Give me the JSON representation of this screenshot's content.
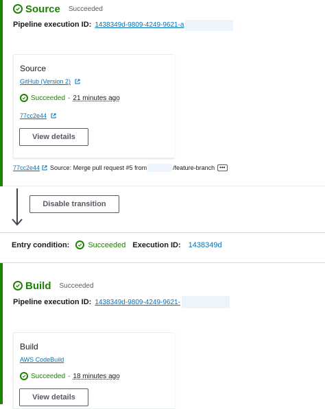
{
  "source_stage": {
    "title": "Source",
    "status": "Succeeded",
    "execution_label": "Pipeline execution ID:",
    "execution_id": "1438349d-9809-4249-9621-a",
    "action": {
      "name": "Source",
      "provider": "GitHub (Version 2)",
      "status": "Succeeded",
      "separator": "-",
      "time": "21 minutes ago",
      "commit": "77cc2e44",
      "view_details": "View details"
    },
    "footer": {
      "commit": "77cc2e44",
      "text": "Source: Merge pull request #5 from",
      "branch": "/feature-branch",
      "more": "•••"
    }
  },
  "transition": {
    "button": "Disable transition"
  },
  "entry": {
    "label": "Entry condition:",
    "status": "Succeeded",
    "execution_label": "Execution ID:",
    "execution_id": "1438349d"
  },
  "build_stage": {
    "title": "Build",
    "status": "Succeeded",
    "execution_label": "Pipeline execution ID:",
    "execution_id": "1438349d-9809-4249-9621-",
    "action": {
      "name": "Build",
      "provider": "AWS CodeBuild",
      "status": "Succeeded",
      "separator": "-",
      "time": "18 minutes ago",
      "view_details": "View details"
    }
  },
  "colors": {
    "success": "#1d8102",
    "link": "#0073bb",
    "text": "#16191f"
  }
}
